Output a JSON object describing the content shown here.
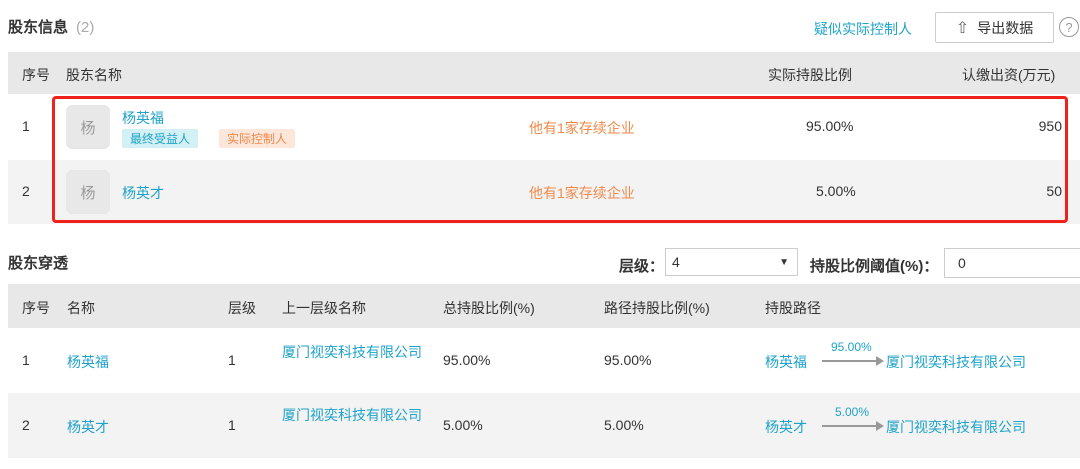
{
  "shareholders": {
    "title": "股东信息",
    "count": "(2)",
    "suspected_link": "疑似实际控制人",
    "export_label": "导出数据",
    "help": "?",
    "columns": [
      "序号",
      "股东名称",
      "实际持股比例",
      "认缴出资(万元)"
    ],
    "rows": [
      {
        "index": "1",
        "avatar": "杨",
        "name": "杨英福",
        "tags": [
          "最终受益人",
          "实际控制人"
        ],
        "enterprises": "他有1家存续企业",
        "ratio": "95.00%",
        "capital": "950"
      },
      {
        "index": "2",
        "avatar": "杨",
        "name": "杨英才",
        "tags": [],
        "enterprises": "他有1家存续企业",
        "ratio": "5.00%",
        "capital": "50"
      }
    ]
  },
  "penetration": {
    "title": "股东穿透",
    "level_label": "层级：",
    "level_value": "4",
    "threshold_label": "持股比例阈值(%)：",
    "threshold_value": "0",
    "columns": [
      "序号",
      "名称",
      "层级",
      "上一层级名称",
      "总持股比例(%)",
      "路径持股比例(%)",
      "持股路径"
    ],
    "rows": [
      {
        "index": "1",
        "name": "杨英福",
        "level": "1",
        "parent": "厦门视奕科技有限公司",
        "total": "95.00%",
        "path_ratio": "95.00%",
        "path_from": "杨英福",
        "path_pct": "95.00%",
        "path_to": "厦门视奕科技有限公司"
      },
      {
        "index": "2",
        "name": "杨英才",
        "level": "1",
        "parent": "厦门视奕科技有限公司",
        "total": "5.00%",
        "path_ratio": "5.00%",
        "path_from": "杨英才",
        "path_pct": "5.00%",
        "path_to": "厦门视奕科技有限公司"
      }
    ]
  }
}
